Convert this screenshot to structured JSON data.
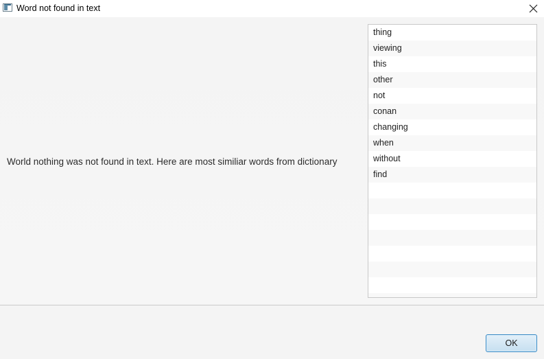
{
  "window": {
    "title": "Word not found in text"
  },
  "message": "World nothing was not found in text. Here are most similiar words from dictionary",
  "list": {
    "items": [
      "thing",
      "viewing",
      "this",
      "other",
      "not",
      "conan",
      "changing",
      "when",
      "without",
      "find",
      "",
      "",
      "",
      "",
      "",
      "",
      "",
      ""
    ]
  },
  "footer": {
    "ok_label": "OK"
  },
  "colors": {
    "ok_border": "#3a8ac4",
    "ok_fill": "#c6dff0"
  }
}
